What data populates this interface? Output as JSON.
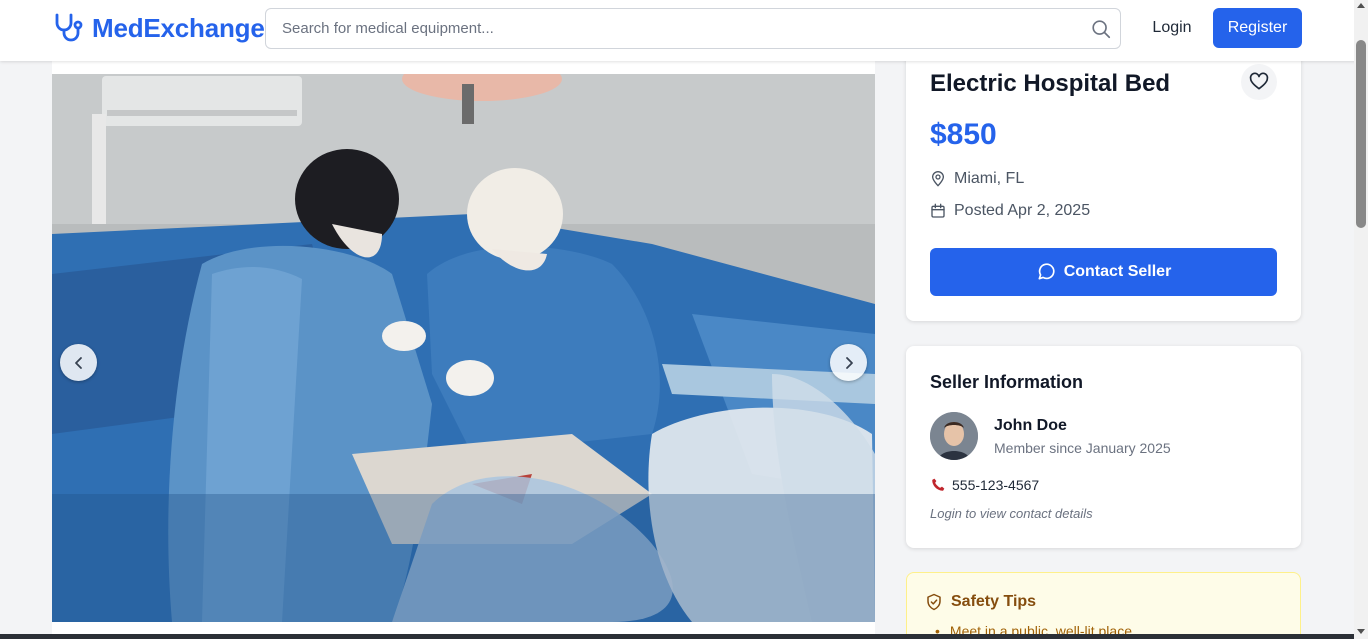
{
  "header": {
    "brand": "MedExchange",
    "search_placeholder": "Search for medical equipment...",
    "login_label": "Login",
    "register_label": "Register",
    "brand_color": "#2563eb"
  },
  "gallery": {
    "prev_icon": "chevron-left-icon",
    "next_icon": "chevron-right-icon"
  },
  "listing": {
    "title": "Electric Hospital Bed",
    "price": "$850",
    "location": "Miami, FL",
    "posted": "Posted Apr 2, 2025",
    "contact_label": "Contact Seller",
    "favorite_icon": "heart-icon"
  },
  "seller": {
    "heading": "Seller Information",
    "name": "John Doe",
    "member_since": "Member since January 2025",
    "phone": "555-123-4567",
    "login_note": "Login to view contact details"
  },
  "safety": {
    "heading": "Safety Tips",
    "tips": [
      "Meet in a public, well-lit place"
    ]
  }
}
